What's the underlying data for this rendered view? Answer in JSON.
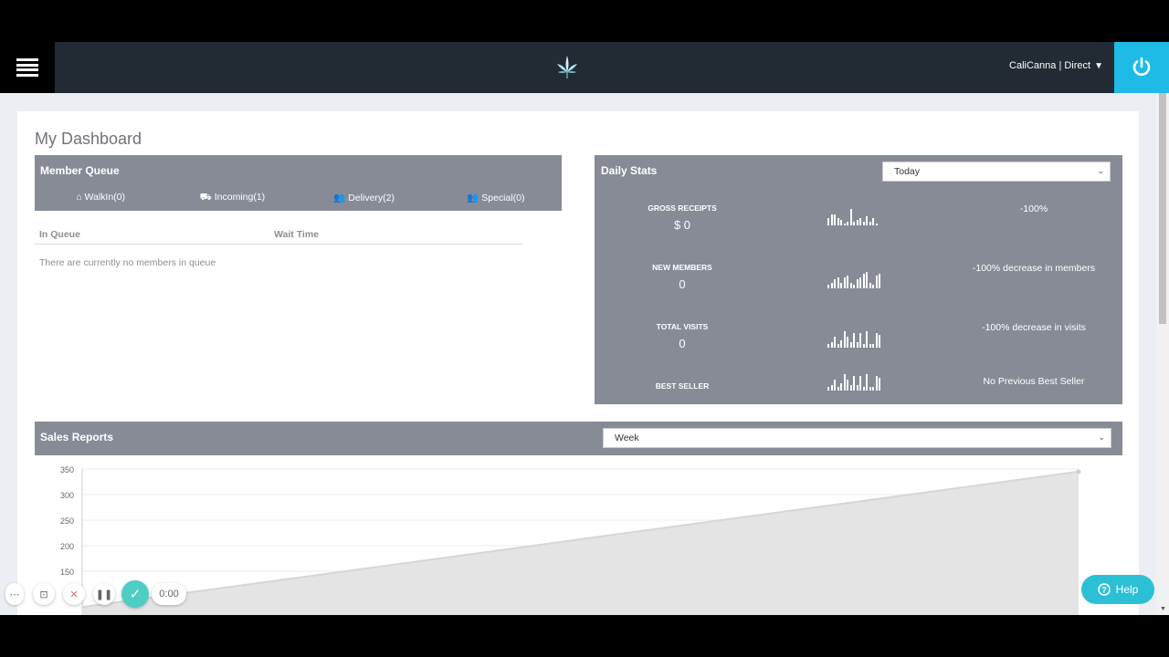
{
  "header": {
    "account_label": "CaliCanna | Direct",
    "accent_color": "#1ebbe6"
  },
  "page_title": "My Dashboard",
  "member_queue": {
    "title": "Member Queue",
    "tabs": [
      {
        "label": "WalkIn(0)",
        "icon": "home-icon"
      },
      {
        "label": "Incoming(1)",
        "icon": "cart-icon"
      },
      {
        "label": "Delivery(2)",
        "icon": "users-icon"
      },
      {
        "label": "Special(0)",
        "icon": "users-icon"
      }
    ],
    "columns": [
      "In Queue",
      "Wait Time"
    ],
    "empty_message": "There are currently no members in queue"
  },
  "daily_stats": {
    "title": "Daily Stats",
    "period": "Today",
    "rows": [
      {
        "label": "GROSS RECEIPTS",
        "value": "$ 0",
        "note": "-100%",
        "spark": [
          0.4,
          0.6,
          0.6,
          0.4,
          0.3,
          0.1,
          0.2,
          0.9,
          0.2,
          0.3,
          0.4,
          0.2,
          0.5,
          0.2,
          0.4,
          0.1
        ]
      },
      {
        "label": "NEW MEMBERS",
        "value": "0",
        "note": "-100% decrease in members",
        "spark": [
          0.2,
          0.3,
          0.5,
          0.6,
          0.3,
          0.6,
          0.7,
          0.3,
          0.2,
          0.5,
          0.6,
          0.8,
          0.9,
          0.3,
          0.2,
          0.7,
          0.8
        ]
      },
      {
        "label": "TOTAL VISITS",
        "value": "0",
        "note": "-100% decrease in visits",
        "spark": [
          0.2,
          0.3,
          0.6,
          0.2,
          0.4,
          0.9,
          0.6,
          0.3,
          0.8,
          0.3,
          0.8,
          0.2,
          0.9,
          0.2,
          0.2,
          0.8,
          0.7
        ]
      },
      {
        "label": "BEST SELLER",
        "value": "",
        "note": "No Previous Best Seller",
        "spark": [
          0.2,
          0.3,
          0.6,
          0.2,
          0.4,
          0.9,
          0.6,
          0.3,
          0.8,
          0.3,
          0.8,
          0.2,
          0.9,
          0.2,
          0.2,
          0.8,
          0.7
        ]
      }
    ]
  },
  "sales_reports": {
    "title": "Sales Reports",
    "period": "Week"
  },
  "chart_data": {
    "type": "area",
    "y_ticks": [
      350,
      300,
      250,
      200,
      150
    ],
    "ylim": [
      100,
      350
    ],
    "x": [
      0,
      1
    ],
    "values": [
      null,
      345
    ],
    "series": [
      {
        "name": "",
        "values": [
          80,
          345
        ]
      }
    ],
    "grid": true
  },
  "recorder": {
    "timer": "0:00"
  },
  "help": {
    "label": "Help"
  }
}
